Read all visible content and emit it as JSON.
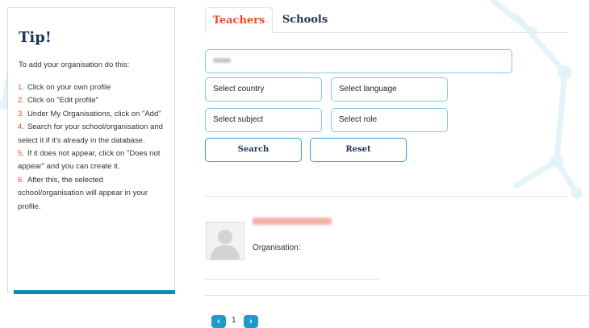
{
  "tip": {
    "title": "Tip!",
    "intro": "To add your organisation do this:",
    "steps": [
      {
        "num": "1.",
        "text": "Click on your own profile"
      },
      {
        "num": "2.",
        "text": "Click on \"Edit profile\""
      },
      {
        "num": "3.",
        "text": "Under My Organisations, click on \"Add\""
      },
      {
        "num": "4.",
        "text": "Search for your school/organisation and select it if it's already in the database."
      },
      {
        "num": "5.",
        "text": "If it does not appear, click on \"Does not appear\" and you can create it."
      },
      {
        "num": "6.",
        "text": "After this, the selected school/organisation will appear in your profile."
      }
    ]
  },
  "tabs": {
    "teachers": "Teachers",
    "schools": "Schools",
    "active": "Teachers"
  },
  "form": {
    "country_select": "Select country",
    "language_select": "Select language",
    "subject_select": "Select subject",
    "role_select": "Select role",
    "search_button": "Search",
    "reset_button": "Reset"
  },
  "result": {
    "organisation_label": "Organisation:"
  },
  "pagination": {
    "prev_icon": "chevron-left-icon",
    "current_page": "1",
    "next_icon": "chevron-right-icon"
  },
  "colors": {
    "accent_orange": "#e0512a",
    "heading_navy": "#1d3557",
    "border_cyan": "#7ccde3",
    "button_cyan": "#2aa7cf",
    "pager_blue": "#1e9cc9",
    "tip_bar": "#0e8bb0"
  }
}
